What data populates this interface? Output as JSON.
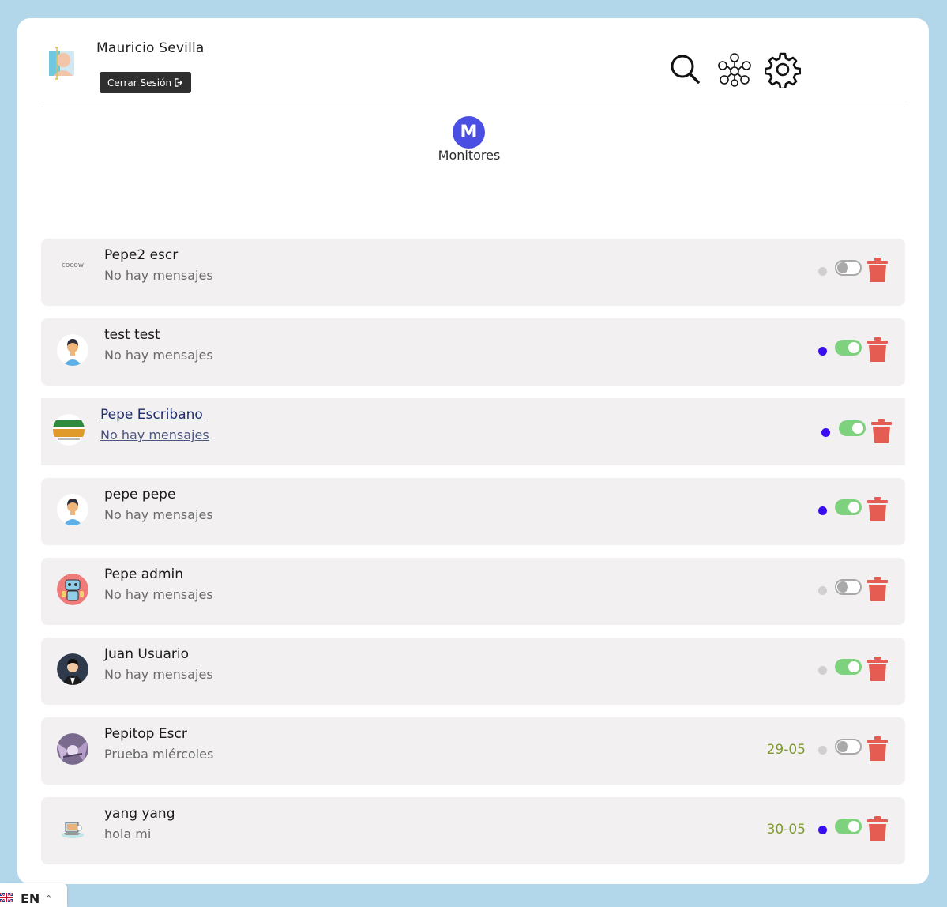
{
  "header": {
    "user_name": "Mauricio Sevilla",
    "logout_label": "Cerrar Sesión",
    "icons": [
      "search-icon",
      "network-icon",
      "gear-icon"
    ]
  },
  "tab": {
    "initial": "M",
    "label": "Monitores",
    "color": "#4a4ee3"
  },
  "rows": [
    {
      "name": "Pepe2 escr",
      "message": "No hay mensajes",
      "date": "",
      "online": false,
      "enabled": false,
      "avatar": "cocow-logo"
    },
    {
      "name": "test test",
      "message": "No hay mensajes",
      "date": "",
      "online": true,
      "enabled": true,
      "avatar": "person-avatar"
    },
    {
      "name": "Pepe Escribano",
      "message": "No hay mensajes",
      "date": "",
      "online": true,
      "enabled": true,
      "avatar": "brand-logo"
    },
    {
      "name": "pepe pepe",
      "message": "No hay mensajes",
      "date": "",
      "online": true,
      "enabled": true,
      "avatar": "person-avatar"
    },
    {
      "name": "Pepe admin",
      "message": "No hay mensajes",
      "date": "",
      "online": false,
      "enabled": false,
      "avatar": "robot-avatar"
    },
    {
      "name": "Juan Usuario",
      "message": "No hay mensajes",
      "date": "",
      "online": false,
      "enabled": true,
      "avatar": "waiter-avatar"
    },
    {
      "name": "Pepitop Escr",
      "message": "Prueba miércoles",
      "date": "29-05",
      "online": false,
      "enabled": false,
      "avatar": "photo-avatar"
    },
    {
      "name": "yang yang",
      "message": "hola mi",
      "date": "30-05",
      "online": true,
      "enabled": true,
      "avatar": "laptop-avatar"
    }
  ],
  "colors": {
    "online_dot": "#3a0ef0",
    "offline_dot": "#d0d0d0",
    "toggle_on": "#7ed27e",
    "trash": "#e45c52",
    "date": "#7e9a2e"
  },
  "language": {
    "label": "EN",
    "flag": "uk-flag-icon"
  }
}
